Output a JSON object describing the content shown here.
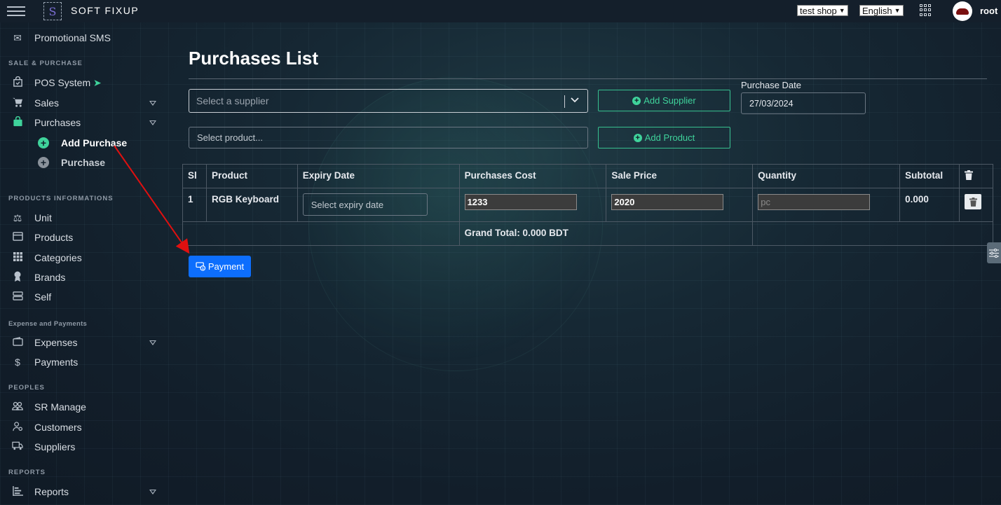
{
  "topbar": {
    "brand": "SOFT FIXUP",
    "shop_select": "test shop",
    "language_select": "English",
    "username": "root"
  },
  "sidebar": {
    "top_item": "Promotional SMS",
    "sections": {
      "sale_purchase": "SALE & PURCHASE",
      "products_info": "PRODUCTS INFORMATIONS",
      "expense_payments": "Expense and Payments",
      "peoples": "PEOPLES",
      "reports": "REPORTS"
    },
    "items": {
      "pos": "POS System",
      "sales": "Sales",
      "purchases": "Purchases",
      "add_purchase": "Add Purchase",
      "purchase": "Purchase",
      "unit": "Unit",
      "products": "Products",
      "categories": "Categories",
      "brands": "Brands",
      "self": "Self",
      "expenses": "Expenses",
      "payments": "Payments",
      "sr_manage": "SR Manage",
      "customers": "Customers",
      "suppliers": "Suppliers",
      "reports": "Reports"
    }
  },
  "main": {
    "title": "Purchases List",
    "supplier_placeholder": "Select a supplier",
    "add_supplier": "Add Supplier",
    "purchase_date_label": "Purchase Date",
    "purchase_date": "27/03/2024",
    "product_placeholder": "Select product...",
    "add_product": "Add Product",
    "table": {
      "headers": [
        "Sl",
        "Product",
        "Expiry Date",
        "Purchases Cost",
        "Sale Price",
        "Quantity",
        "Subtotal"
      ],
      "rows": [
        {
          "sl": "1",
          "product": "RGB Keyboard",
          "expiry_placeholder": "Select expiry date",
          "cost": "1233",
          "sale_price": "2020",
          "quantity_placeholder": "pc",
          "subtotal": "0.000"
        }
      ],
      "grand_total": "Grand Total: 0.000 BDT"
    },
    "payment_button": "Payment"
  },
  "colors": {
    "accent_green": "#3fd39b",
    "primary_blue": "#0d6efd",
    "annotation_red": "#e01010"
  }
}
